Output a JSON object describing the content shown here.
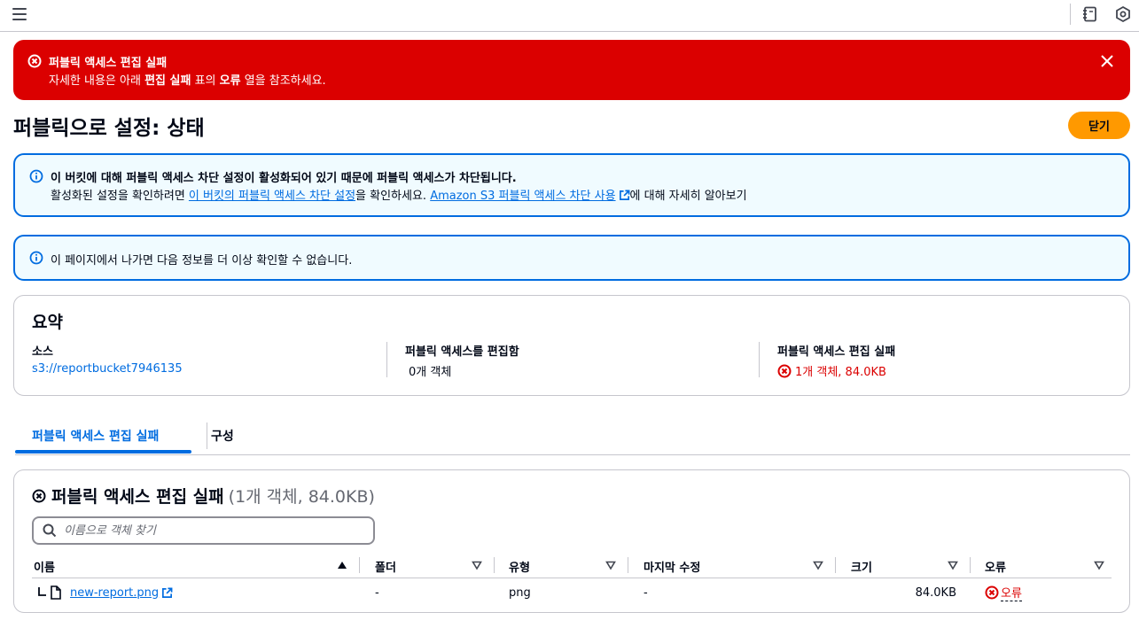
{
  "topbar": {
    "icons": [
      "menu-icon",
      "notes-icon",
      "settings-icon"
    ]
  },
  "flash": {
    "title": "퍼블릭 액세스 편집 실패",
    "desc_prefix": "자세한 내용은 아래 ",
    "desc_bold1": "편집 실패",
    "desc_mid": " 표의 ",
    "desc_bold2": "오류",
    "desc_suffix": " 열을 참조하세요."
  },
  "page": {
    "title": "퍼블릭으로 설정: 상태",
    "close_button": "닫기"
  },
  "info1": {
    "title": "이 버킷에 대해 퍼블릭 액세스 차단 설정이 활성화되어 있기 때문에 퍼블릭 액세스가 차단됩니다.",
    "text_prefix": "활성화된 설정을 확인하려면 ",
    "link1": "이 버킷의 퍼블릭 액세스 차단 설정",
    "text_mid": "을 확인하세요. ",
    "link2": "Amazon S3 퍼블릭 액세스 차단 사용",
    "text_suffix": "에 대해 자세히 알아보기"
  },
  "info2": {
    "text": "이 페이지에서 나가면 다음 정보를 더 이상 확인할 수 없습니다."
  },
  "summary": {
    "title": "요약",
    "source_label": "소스",
    "source_value": "s3://reportbucket7946135",
    "edited_label": "퍼블릭 액세스를 편집함",
    "edited_value": "0개 객체",
    "failed_label": "퍼블릭 액세스 편집 실패",
    "failed_value": "1개 객체, 84.0KB"
  },
  "tabs": [
    {
      "label": "퍼블릭 액세스 편집 실패",
      "active": true
    },
    {
      "label": "구성",
      "active": false
    }
  ],
  "failed_table": {
    "title": "퍼블릭 액세스 편집 실패",
    "count": "(1개 객체, 84.0KB)",
    "search_placeholder": "이름으로 객체 찾기",
    "columns": [
      "이름",
      "폴더",
      "유형",
      "마지막 수정",
      "크기",
      "오류"
    ],
    "rows": [
      {
        "name": "new-report.png",
        "folder": "-",
        "type": "png",
        "last_modified": "-",
        "size": "84.0KB",
        "error": "오류"
      }
    ]
  },
  "colors": {
    "error": "#db0000",
    "link": "#006ce0",
    "primary_button": "#ff9900",
    "info_bg": "#f0fbff"
  }
}
